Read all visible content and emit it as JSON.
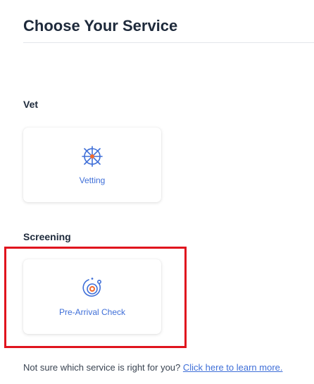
{
  "header": {
    "title": "Choose Your Service"
  },
  "sections": [
    {
      "label": "Vet",
      "card": {
        "label": "Vetting",
        "icon": "vetting-icon"
      }
    },
    {
      "label": "Screening",
      "card": {
        "label": "Pre-Arrival Check",
        "icon": "pre-arrival-check-icon"
      }
    }
  ],
  "footer": {
    "text": "Not sure which service is right for you?",
    "link": "Click here to learn more."
  },
  "colors": {
    "accent": "#3f6fd8",
    "highlight": "#e0141e",
    "icon_orange": "#f26a2e",
    "title": "#1e2a3b"
  }
}
